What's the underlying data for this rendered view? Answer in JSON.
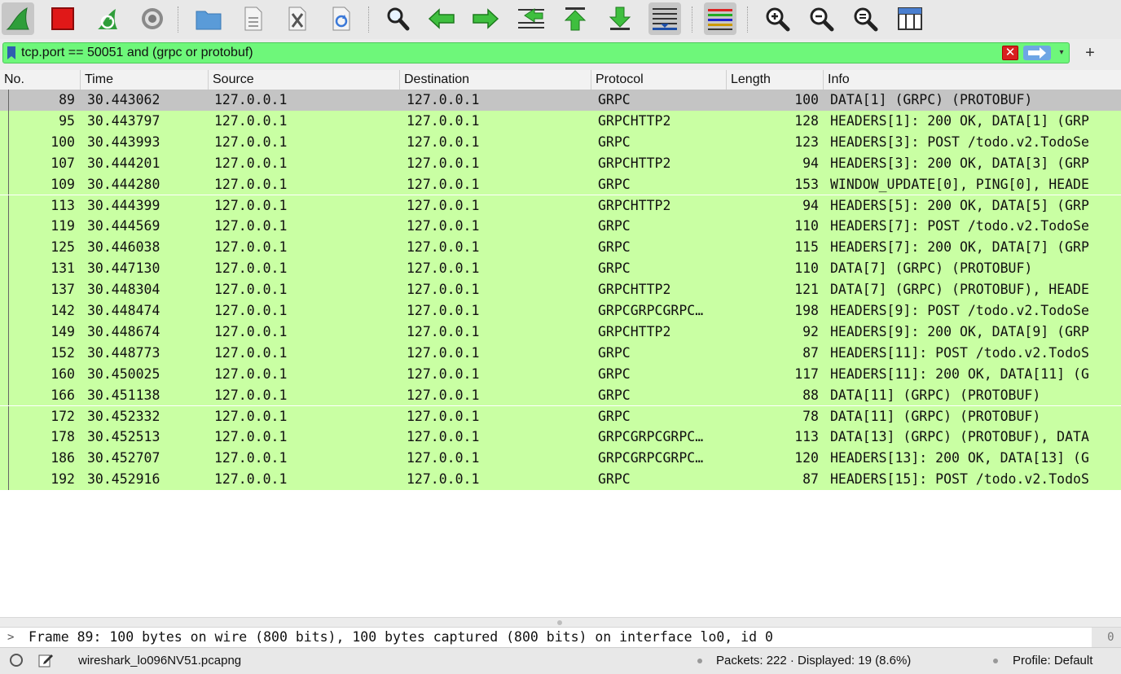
{
  "toolbar": {
    "buttons": [
      {
        "icon": "shark-fin-start-icon"
      },
      {
        "icon": "stop-square-icon"
      },
      {
        "icon": "restart-capture-icon"
      },
      {
        "icon": "capture-options-gear-icon"
      },
      {
        "icon": "open-folder-icon"
      },
      {
        "icon": "save-file-icon"
      },
      {
        "icon": "close-file-icon"
      },
      {
        "icon": "reload-icon"
      },
      {
        "icon": "find-packet-icon"
      },
      {
        "icon": "go-back-icon"
      },
      {
        "icon": "go-forward-icon"
      },
      {
        "icon": "go-to-packet-icon"
      },
      {
        "icon": "first-packet-icon"
      },
      {
        "icon": "last-packet-icon"
      },
      {
        "icon": "auto-scroll-icon"
      },
      {
        "icon": "colorize-icon"
      },
      {
        "icon": "zoom-in-icon"
      },
      {
        "icon": "zoom-out-icon"
      },
      {
        "icon": "normal-size-icon"
      },
      {
        "icon": "resize-columns-icon"
      }
    ]
  },
  "filter": {
    "value": "tcp.port == 50051 and (grpc or protobuf)",
    "add_label": "+",
    "clear_label": "✕",
    "dropdown_label": "▾"
  },
  "columns": {
    "no": "No.",
    "time": "Time",
    "source": "Source",
    "destination": "Destination",
    "protocol": "Protocol",
    "length": "Length",
    "info": "Info"
  },
  "packets": [
    {
      "no": "89",
      "time": "30.443062",
      "source": "127.0.0.1",
      "destination": "127.0.0.1",
      "protocol": "GRPC",
      "length": "100",
      "info": "DATA[1] (GRPC) (PROTOBUF)"
    },
    {
      "no": "95",
      "time": "30.443797",
      "source": "127.0.0.1",
      "destination": "127.0.0.1",
      "protocol": "GRPCHTTP2",
      "length": "128",
      "info": "HEADERS[1]: 200 OK, DATA[1] (GRP"
    },
    {
      "no": "100",
      "time": "30.443993",
      "source": "127.0.0.1",
      "destination": "127.0.0.1",
      "protocol": "GRPC",
      "length": "123",
      "info": "HEADERS[3]: POST /todo.v2.TodoSe"
    },
    {
      "no": "107",
      "time": "30.444201",
      "source": "127.0.0.1",
      "destination": "127.0.0.1",
      "protocol": "GRPCHTTP2",
      "length": "94",
      "info": "HEADERS[3]: 200 OK, DATA[3] (GRP"
    },
    {
      "no": "109",
      "time": "30.444280",
      "source": "127.0.0.1",
      "destination": "127.0.0.1",
      "protocol": "GRPC",
      "length": "153",
      "info": "WINDOW_UPDATE[0], PING[0], HEADE"
    },
    {
      "no": "113",
      "time": "30.444399",
      "source": "127.0.0.1",
      "destination": "127.0.0.1",
      "protocol": "GRPCHTTP2",
      "length": "94",
      "info": "HEADERS[5]: 200 OK, DATA[5] (GRP"
    },
    {
      "no": "119",
      "time": "30.444569",
      "source": "127.0.0.1",
      "destination": "127.0.0.1",
      "protocol": "GRPC",
      "length": "110",
      "info": "HEADERS[7]: POST /todo.v2.TodoSe"
    },
    {
      "no": "125",
      "time": "30.446038",
      "source": "127.0.0.1",
      "destination": "127.0.0.1",
      "protocol": "GRPC",
      "length": "115",
      "info": "HEADERS[7]: 200 OK, DATA[7] (GRP"
    },
    {
      "no": "131",
      "time": "30.447130",
      "source": "127.0.0.1",
      "destination": "127.0.0.1",
      "protocol": "GRPC",
      "length": "110",
      "info": "DATA[7] (GRPC) (PROTOBUF)"
    },
    {
      "no": "137",
      "time": "30.448304",
      "source": "127.0.0.1",
      "destination": "127.0.0.1",
      "protocol": "GRPCHTTP2",
      "length": "121",
      "info": "DATA[7] (GRPC) (PROTOBUF), HEADE"
    },
    {
      "no": "142",
      "time": "30.448474",
      "source": "127.0.0.1",
      "destination": "127.0.0.1",
      "protocol": "GRPCGRPCGRPC…",
      "length": "198",
      "info": "HEADERS[9]: POST /todo.v2.TodoSe"
    },
    {
      "no": "149",
      "time": "30.448674",
      "source": "127.0.0.1",
      "destination": "127.0.0.1",
      "protocol": "GRPCHTTP2",
      "length": "92",
      "info": "HEADERS[9]: 200 OK, DATA[9] (GRP"
    },
    {
      "no": "152",
      "time": "30.448773",
      "source": "127.0.0.1",
      "destination": "127.0.0.1",
      "protocol": "GRPC",
      "length": "87",
      "info": "HEADERS[11]: POST /todo.v2.TodoS"
    },
    {
      "no": "160",
      "time": "30.450025",
      "source": "127.0.0.1",
      "destination": "127.0.0.1",
      "protocol": "GRPC",
      "length": "117",
      "info": "HEADERS[11]: 200 OK, DATA[11] (G"
    },
    {
      "no": "166",
      "time": "30.451138",
      "source": "127.0.0.1",
      "destination": "127.0.0.1",
      "protocol": "GRPC",
      "length": "88",
      "info": "DATA[11] (GRPC) (PROTOBUF)"
    },
    {
      "no": "172",
      "time": "30.452332",
      "source": "127.0.0.1",
      "destination": "127.0.0.1",
      "protocol": "GRPC",
      "length": "78",
      "info": "DATA[11] (GRPC) (PROTOBUF)"
    },
    {
      "no": "178",
      "time": "30.452513",
      "source": "127.0.0.1",
      "destination": "127.0.0.1",
      "protocol": "GRPCGRPCGRPC…",
      "length": "113",
      "info": "DATA[13] (GRPC) (PROTOBUF), DATA"
    },
    {
      "no": "186",
      "time": "30.452707",
      "source": "127.0.0.1",
      "destination": "127.0.0.1",
      "protocol": "GRPCGRPCGRPC…",
      "length": "120",
      "info": "HEADERS[13]: 200 OK, DATA[13] (G"
    },
    {
      "no": "192",
      "time": "30.452916",
      "source": "127.0.0.1",
      "destination": "127.0.0.1",
      "protocol": "GRPC",
      "length": "87",
      "info": "HEADERS[15]: POST /todo.v2.TodoS"
    }
  ],
  "selected_packet": "89",
  "detail": {
    "expander": ">",
    "frame_summary": "Frame 89: 100 bytes on wire (800 bits), 100 bytes captured (800 bits) on interface lo0, id 0",
    "side_value": "0"
  },
  "status": {
    "filename": "wireshark_lo096NV51.pcapng",
    "packets": "Packets: 222 · Displayed: 19 (8.6%)",
    "profile": "Profile: Default"
  },
  "colors": {
    "filter_valid": "#6ef77a",
    "row_grpc": "#c9ffa3",
    "row_selected": "#c4c4c4"
  }
}
